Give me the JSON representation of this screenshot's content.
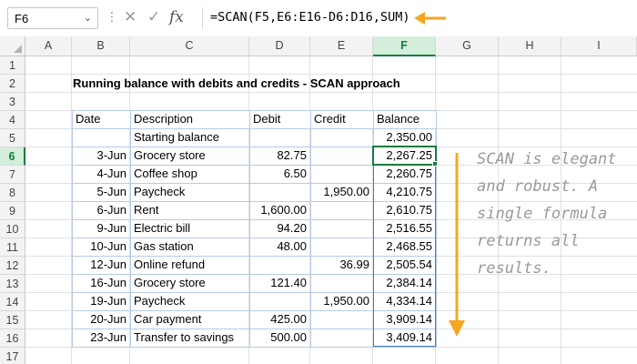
{
  "formula_bar": {
    "name_box": "F6",
    "formula": "=SCAN(F5,E6:E16-D6:D16,SUM)",
    "icons": [
      "cancel-icon",
      "enter-icon",
      "insert-function-icon"
    ],
    "arrow_color": "#f5a623"
  },
  "columns": [
    "A",
    "B",
    "C",
    "D",
    "E",
    "F",
    "G",
    "H",
    "I"
  ],
  "selected_column": "F",
  "rows": [
    "1",
    "2",
    "3",
    "4",
    "5",
    "6",
    "7",
    "8",
    "9",
    "10",
    "11",
    "12",
    "13",
    "14",
    "15",
    "16",
    "17"
  ],
  "selected_row": "6",
  "sheet": {
    "title": "Running balance with debits and credits - SCAN approach",
    "headers": {
      "date": "Date",
      "description": "Description",
      "debit": "Debit",
      "credit": "Credit",
      "balance": "Balance"
    },
    "rows": [
      {
        "date": "",
        "description": "Starting balance",
        "debit": "",
        "credit": "",
        "balance": "2,350.00"
      },
      {
        "date": "3-Jun",
        "description": "Grocery store",
        "debit": "82.75",
        "credit": "",
        "balance": "2,267.25"
      },
      {
        "date": "4-Jun",
        "description": "Coffee shop",
        "debit": "6.50",
        "credit": "",
        "balance": "2,260.75"
      },
      {
        "date": "5-Jun",
        "description": "Paycheck",
        "debit": "",
        "credit": "1,950.00",
        "balance": "4,210.75"
      },
      {
        "date": "6-Jun",
        "description": "Rent",
        "debit": "1,600.00",
        "credit": "",
        "balance": "2,610.75"
      },
      {
        "date": "9-Jun",
        "description": "Electric bill",
        "debit": "94.20",
        "credit": "",
        "balance": "2,516.55"
      },
      {
        "date": "10-Jun",
        "description": "Gas station",
        "debit": "48.00",
        "credit": "",
        "balance": "2,468.55"
      },
      {
        "date": "12-Jun",
        "description": "Online refund",
        "debit": "",
        "credit": "36.99",
        "balance": "2,505.54"
      },
      {
        "date": "16-Jun",
        "description": "Grocery store",
        "debit": "121.40",
        "credit": "",
        "balance": "2,384.14"
      },
      {
        "date": "19-Jun",
        "description": "Paycheck",
        "debit": "",
        "credit": "1,950.00",
        "balance": "4,334.14"
      },
      {
        "date": "20-Jun",
        "description": "Car payment",
        "debit": "425.00",
        "credit": "",
        "balance": "3,909.14"
      },
      {
        "date": "23-Jun",
        "description": "Transfer to savings",
        "debit": "500.00",
        "credit": "",
        "balance": "3,409.14"
      }
    ]
  },
  "note": "SCAN is elegant and robust. A single formula returns all results.",
  "colors": {
    "accent": "#107c41",
    "table_border": "#9cb6d6",
    "spill_border": "#4a78c2",
    "arrow": "#f5a623"
  }
}
